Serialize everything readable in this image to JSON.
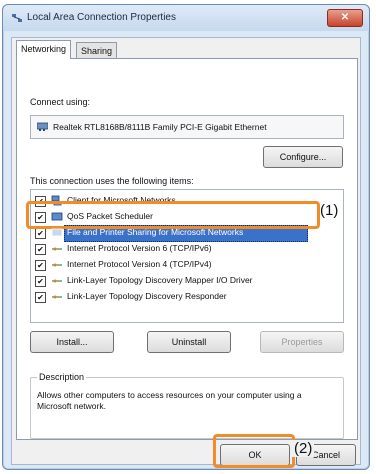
{
  "window": {
    "title": "Local Area Connection Properties",
    "close_glyph": "✕"
  },
  "tabs": [
    {
      "label": "Networking"
    },
    {
      "label": "Sharing"
    }
  ],
  "connect_using_label": "Connect using:",
  "adapter_name": "Realtek RTL8168B/8111B Family PCI-E Gigabit Ethernet",
  "configure_label": "Configure...",
  "items_label": "This connection uses the following items:",
  "items": [
    {
      "label": "Client for Microsoft Networks",
      "checked": true,
      "icon": "network-client-icon"
    },
    {
      "label": "QoS Packet Scheduler",
      "checked": true,
      "icon": "network-service-icon"
    },
    {
      "label": "File and Printer Sharing for Microsoft Networks",
      "checked": true,
      "icon": "network-service-icon",
      "selected": true
    },
    {
      "label": "Internet Protocol Version 6 (TCP/IPv6)",
      "checked": true,
      "icon": "protocol-icon"
    },
    {
      "label": "Internet Protocol Version 4 (TCP/IPv4)",
      "checked": true,
      "icon": "protocol-icon"
    },
    {
      "label": "Link-Layer Topology Discovery Mapper I/O Driver",
      "checked": true,
      "icon": "protocol-icon"
    },
    {
      "label": "Link-Layer Topology Discovery Responder",
      "checked": true,
      "icon": "protocol-icon"
    }
  ],
  "buttons": {
    "install": "Install...",
    "uninstall": "Uninstall",
    "properties": "Properties",
    "ok": "OK",
    "cancel": "Cancel"
  },
  "description": {
    "legend": "Description",
    "text": "Allows other computers to access resources on your computer using a Microsoft network."
  },
  "callouts": {
    "one": "(1)",
    "two": "(2)"
  },
  "colors": {
    "highlight": "#f28c28",
    "selection": "#3b72c9"
  }
}
